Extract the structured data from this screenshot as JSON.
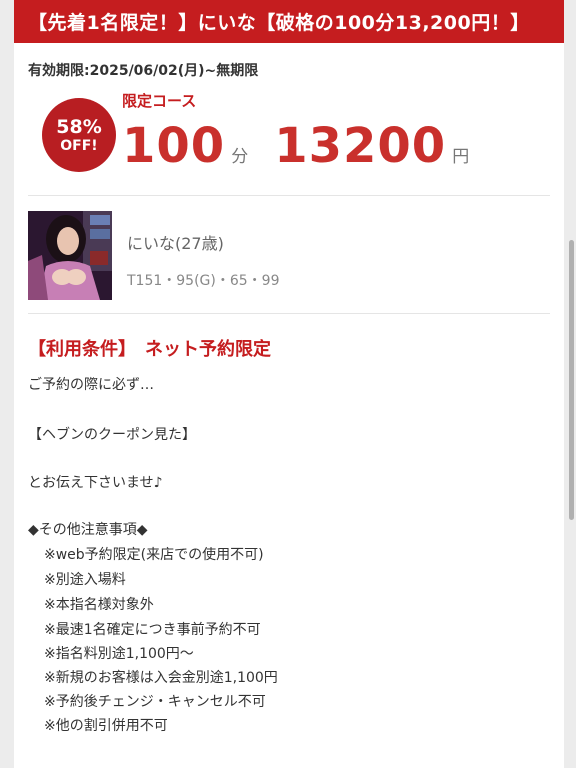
{
  "header": {
    "title": "【先着1名限定！】にいな【破格の100分13,200円！】"
  },
  "validity": "有効期限:2025/06/02(月)~無期限",
  "badge": {
    "percent": "58%",
    "off": "OFF!"
  },
  "course": {
    "label": "限定コース",
    "minutes": "100",
    "minutes_unit": "分",
    "price": "13200",
    "price_unit": "円"
  },
  "girl": {
    "name": "にいな(27歳)",
    "stats": "T151・95(G)・65・99"
  },
  "conditions": {
    "title": "【利用条件】　ネット予約限定",
    "line1": "ご予約の際に必ず…",
    "line2": "【ヘブンのクーポン見た】",
    "line3": "とお伝え下さいませ♪",
    "notes_header": "◆その他注意事項◆",
    "notes": [
      "※web予約限定(来店での使用不可)",
      "※別途入場料",
      "※本指名様対象外",
      "※最速1名確定につき事前予約不可",
      "※指名料別途1,100円〜",
      "※新規のお客様は入会金別途1,100円",
      "※予約後チェンジ・キャンセル不可",
      "※他の割引併用不可"
    ]
  }
}
